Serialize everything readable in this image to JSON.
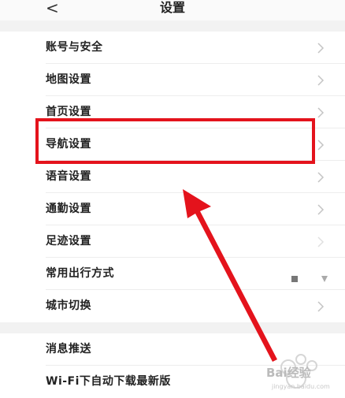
{
  "header": {
    "title": "设置",
    "back_glyph": "<"
  },
  "settings": [
    {
      "label": "账号与安全"
    },
    {
      "label": "地图设置"
    },
    {
      "label": "首页设置"
    },
    {
      "label": "导航设置"
    },
    {
      "label": "语音设置"
    },
    {
      "label": "通勤设置"
    },
    {
      "label": "足迹设置"
    },
    {
      "label": "常用出行方式"
    },
    {
      "label": "城市切换"
    },
    {
      "label": "消息推送"
    },
    {
      "label": "Wi-Fi下自动下载最新版"
    }
  ],
  "annotation": {
    "highlight_color": "#e4131c",
    "highlighted_item": "导航设置"
  },
  "watermark": {
    "text": "Bai经验",
    "sub": "jingyan.baidu.com"
  }
}
